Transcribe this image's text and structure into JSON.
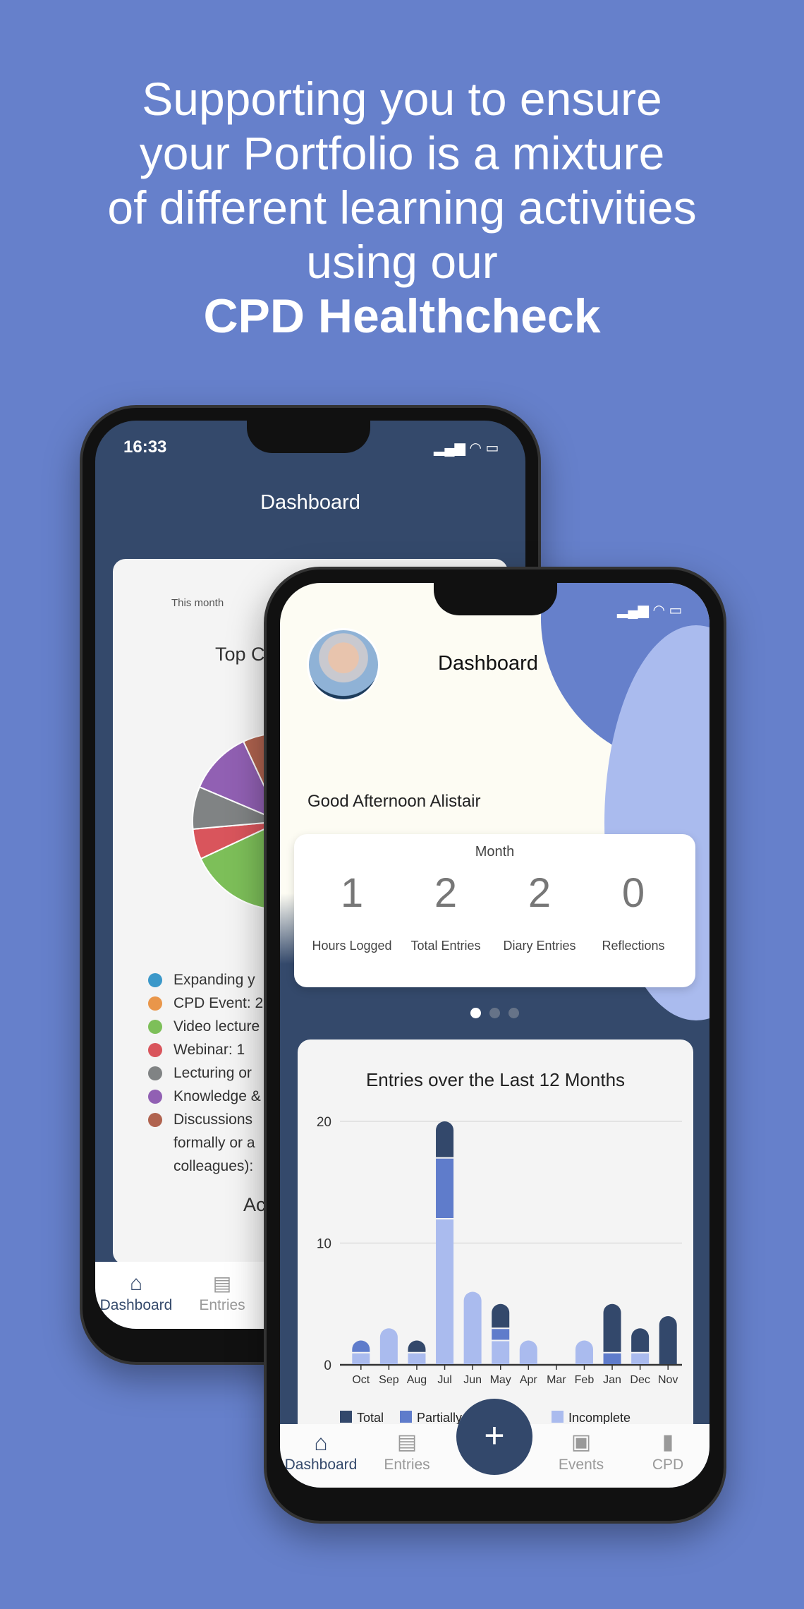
{
  "headline": {
    "lines": [
      "Supporting you to ensure",
      "your Portfolio is a mixture",
      "of different learning activities",
      "using our"
    ],
    "bold": "CPD Healthcheck"
  },
  "colors": {
    "background": "#6680cb",
    "header": "#34496b",
    "total": "#33486b",
    "partial": "#5f7ccb",
    "incomplete": "#aabbee"
  },
  "back_phone": {
    "time": "16:33",
    "title": "Dashboard",
    "period": "This month",
    "card_title": "Top C",
    "section_title": "Ac",
    "legend": [
      {
        "label": "Expanding y",
        "color": "#3b98c9"
      },
      {
        "label": "CPD Event: 2",
        "color": "#e9964a"
      },
      {
        "label": "Video lecture",
        "color": "#7dbf59"
      },
      {
        "label": "Webinar: 1",
        "color": "#d9555c"
      },
      {
        "label": "Lecturing or",
        "color": "#808384"
      },
      {
        "label": "Knowledge &",
        "color": "#9160b3"
      },
      {
        "label": "Discussions",
        "color": "#b0634f",
        "extra": [
          "formally or a",
          "colleagues):"
        ]
      }
    ],
    "nav": [
      {
        "label": "Dashboard",
        "icon": "home-icon",
        "active": true
      },
      {
        "label": "Entries",
        "icon": "document-icon",
        "active": false
      }
    ]
  },
  "front_phone": {
    "title": "Dashboard",
    "greeting": "Good Afternoon Alistair",
    "stats": {
      "period": "Month",
      "items": [
        {
          "value": "1",
          "label": "Hours Logged"
        },
        {
          "value": "2",
          "label": "Total Entries"
        },
        {
          "value": "2",
          "label": "Diary Entries"
        },
        {
          "value": "0",
          "label": "Reflections"
        }
      ]
    },
    "carousel": {
      "pages": 3,
      "active": 1
    },
    "nav": [
      {
        "label": "Dashboard",
        "icon": "home-icon",
        "active": true
      },
      {
        "label": "Entries",
        "icon": "document-icon",
        "active": false
      },
      {
        "label": "Events",
        "icon": "calendar-icon",
        "active": false
      },
      {
        "label": "CPD",
        "icon": "book-icon",
        "active": false
      }
    ],
    "fab": "+"
  },
  "chart_data": {
    "type": "bar",
    "stacked": true,
    "title": "Entries over the Last 12 Months",
    "categories": [
      "Oct",
      "Sep",
      "Aug",
      "Jul",
      "Jun",
      "May",
      "Apr",
      "Mar",
      "Feb",
      "Jan",
      "Dec",
      "Nov"
    ],
    "series": [
      {
        "name": "Incomplete",
        "color": "#aabbee",
        "values": [
          1,
          3,
          1,
          12,
          6,
          2,
          2,
          0,
          2,
          0,
          1,
          0
        ]
      },
      {
        "name": "Partially Complete",
        "color": "#5f7ccb",
        "values": [
          1,
          0,
          0,
          5,
          0,
          1,
          0,
          0,
          0,
          1,
          0,
          0
        ]
      },
      {
        "name": "Total",
        "color": "#33486b",
        "values": [
          0,
          0,
          1,
          3,
          0,
          2,
          0,
          0,
          0,
          4,
          2,
          4
        ]
      }
    ],
    "yticks": [
      0,
      10,
      20
    ],
    "ylim": [
      0,
      20
    ],
    "grid": true,
    "legend": "bottom",
    "legend_order": [
      "Total",
      "Partially Complete",
      "Incomplete"
    ]
  }
}
